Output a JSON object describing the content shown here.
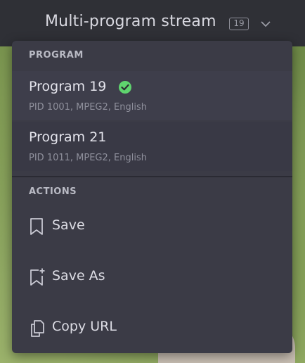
{
  "header": {
    "title": "Multi-program stream",
    "badge": "19"
  },
  "menu": {
    "program_section": "PROGRAM",
    "programs": [
      {
        "name": "Program 19",
        "details": "PID 1001, MPEG2, English",
        "selected": true
      },
      {
        "name": "Program 21",
        "details": "PID 1011, MPEG2, English",
        "selected": false
      }
    ],
    "actions_section": "ACTIONS",
    "actions": [
      {
        "label": "Save",
        "icon": "bookmark-icon"
      },
      {
        "label": "Save As",
        "icon": "bookmark-plus-icon"
      },
      {
        "label": "Copy URL",
        "icon": "copy-icon"
      }
    ]
  },
  "colors": {
    "check": "#5fd46e",
    "menu_bg": "#3b3b46"
  }
}
